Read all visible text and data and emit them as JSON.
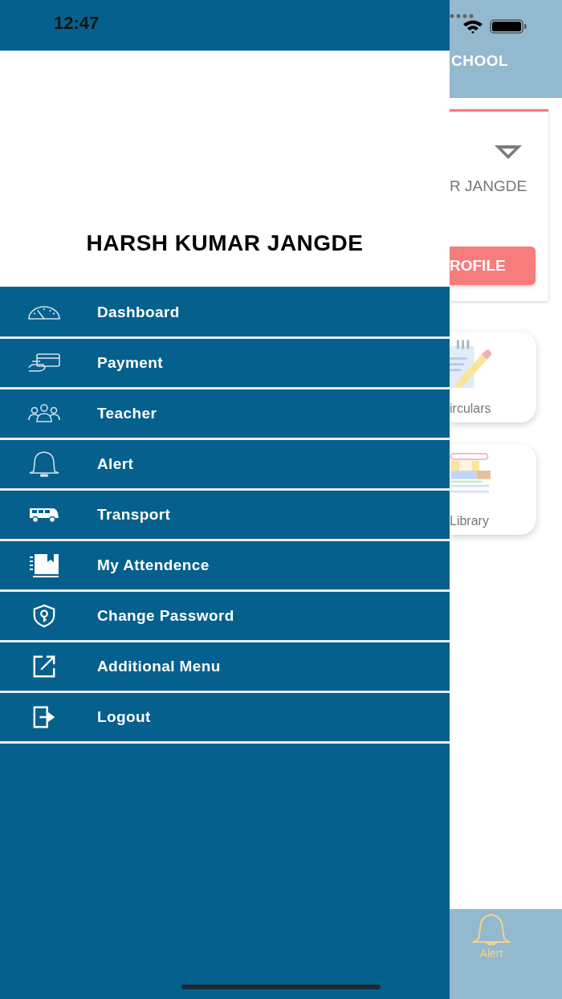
{
  "status_bar": {
    "time": "12:47"
  },
  "background_page": {
    "header_title": "CHOOL",
    "profile_name": "R JANGDE",
    "profile_button": "ROFILE",
    "tiles": [
      {
        "label": "irculars"
      },
      {
        "label": "Library"
      }
    ],
    "bottom_tab": {
      "label": "Alert",
      "selected": true
    }
  },
  "drawer": {
    "user_name": "HARSH KUMAR JANGDE",
    "items": [
      {
        "label": "Dashboard"
      },
      {
        "label": "Payment"
      },
      {
        "label": "Teacher"
      },
      {
        "label": "Alert"
      },
      {
        "label": "Transport"
      },
      {
        "label": "My Attendence"
      },
      {
        "label": "Change Password"
      },
      {
        "label": "Additional Menu"
      },
      {
        "label": "Logout"
      }
    ]
  }
}
